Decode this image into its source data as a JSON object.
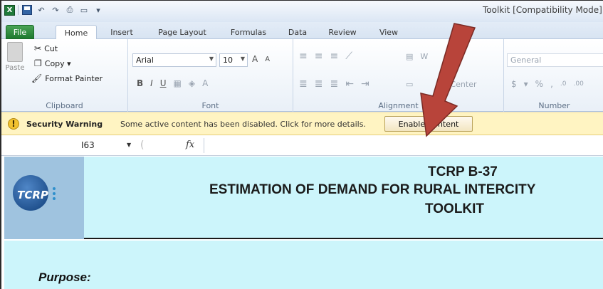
{
  "window": {
    "title": "Toolkit [Compatibility Mode]"
  },
  "quick_access": {
    "app_icon_label": "X",
    "icons": [
      "save-icon",
      "undo-icon",
      "redo-icon",
      "print-preview-icon",
      "print-icon",
      "customize-icon"
    ]
  },
  "tabs": [
    {
      "label": "File"
    },
    {
      "label": "Home"
    },
    {
      "label": "Insert"
    },
    {
      "label": "Page Layout"
    },
    {
      "label": "Formulas"
    },
    {
      "label": "Data"
    },
    {
      "label": "Review"
    },
    {
      "label": "View"
    }
  ],
  "ribbon": {
    "clipboard": {
      "paste": "Paste",
      "cut": "Cut",
      "copy": "Copy ▾",
      "format_painter": "Format Painter",
      "label": "Clipboard"
    },
    "font": {
      "name": "Arial",
      "size": "10",
      "label": "Font",
      "bold": "B",
      "italic": "I",
      "underline": "U",
      "grow": "A",
      "shrink": "A"
    },
    "alignment": {
      "wrap": "W",
      "merge": "& Center",
      "label": "Alignment"
    },
    "number": {
      "format": "General",
      "currency": "$",
      "percent": "%",
      "comma": ",",
      "inc": ".0",
      "dec": ".00",
      "label": "Number"
    }
  },
  "security": {
    "title": "Security Warning",
    "message": "Some active content has been disabled. Click for more details.",
    "button": "Enable Content"
  },
  "formula_bar": {
    "name_box": "I63",
    "fx": "fx",
    "value": ""
  },
  "sheet": {
    "logo_text": "TCRP",
    "line1": "TCRP B-37",
    "line2": "ESTIMATION OF DEMAND FOR RURAL INTERCITY",
    "line3": "TOOLKIT",
    "purpose": "Purpose:"
  },
  "colors": {
    "sheet_background": "#ccf5fb",
    "warning_bar": "#fff4c2",
    "arrow": "#b8443a",
    "file_tab": "#2f8d3e"
  }
}
